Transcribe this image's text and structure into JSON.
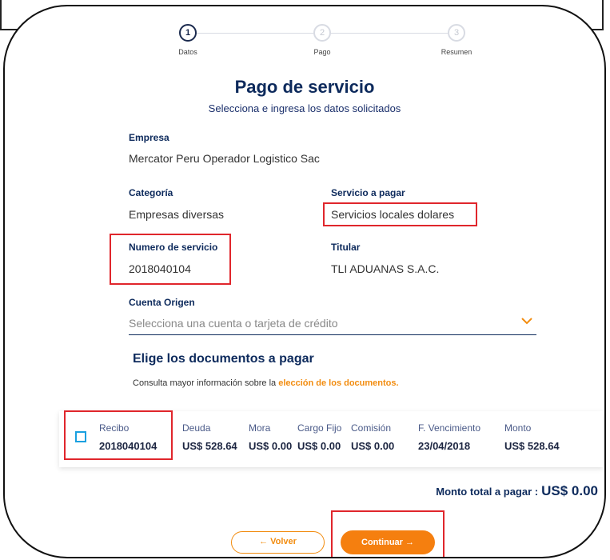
{
  "stepper": {
    "steps": [
      {
        "number": "1",
        "label": "Datos"
      },
      {
        "number": "2",
        "label": "Pago"
      },
      {
        "number": "3",
        "label": "Resumen"
      }
    ]
  },
  "header": {
    "title": "Pago de servicio",
    "subtitle": "Selecciona e ingresa los datos solicitados"
  },
  "fields": {
    "empresa_label": "Empresa",
    "empresa_value": "Mercator Peru Operador Logistico Sac",
    "categoria_label": "Categoría",
    "categoria_value": "Empresas diversas",
    "servicio_label": "Servicio a pagar",
    "servicio_value": "Servicios locales dolares",
    "numero_label": "Numero de servicio",
    "numero_value": "2018040104",
    "titular_label": "Titular",
    "titular_value": "TLI ADUANAS S.A.C.",
    "cuenta_label": "Cuenta Origen",
    "cuenta_placeholder": "Selecciona una cuenta o tarjeta de crédito"
  },
  "documents": {
    "title": "Elige los documentos a pagar",
    "info_text": "Consulta mayor información sobre la ",
    "info_link": "elección de los documentos.",
    "columns": [
      "Recibo",
      "Deuda",
      "Mora",
      "Cargo Fijo",
      "Comisión",
      "F. Vencimiento",
      "Monto"
    ],
    "row": [
      "2018040104",
      "US$ 528.64",
      "US$ 0.00",
      "US$ 0.00",
      "US$ 0.00",
      "23/04/2018",
      "US$ 528.64"
    ]
  },
  "total": {
    "label": "Monto total a pagar :",
    "amount": "US$ 0.00"
  },
  "buttons": {
    "back": "← Volver",
    "next": "Continuar →"
  },
  "colors": {
    "brand_navy": "#0d2a5c",
    "accent_orange": "#f57f0f",
    "highlight_red": "#e0262c",
    "checkbox_blue": "#1aa0e0"
  }
}
